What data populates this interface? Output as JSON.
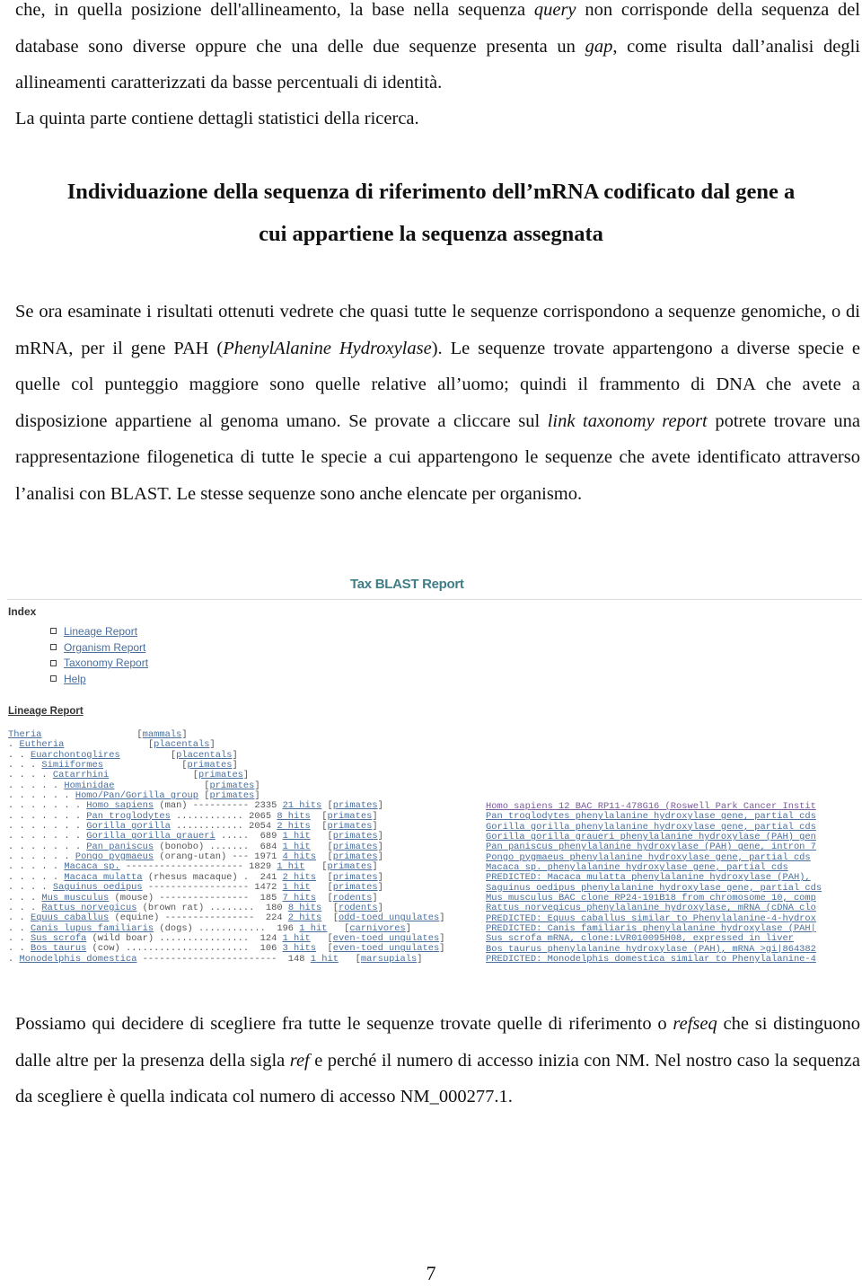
{
  "intro": {
    "p1_a": "che, in quella posizione dell'allineamento, la base nella sequenza ",
    "p1_query": "query",
    "p1_b": " non corrisponde della sequenza del database sono diverse oppure che una delle due sequenze presenta un ",
    "p1_gap": "gap",
    "p1_c": ", come risulta dall’analisi degli allineamenti caratterizzati da basse percentuali di identità.",
    "p2": "La quinta parte contiene dettagli statistici della ricerca."
  },
  "section_heading": {
    "line1": "Individuazione della sequenza di riferimento dell’mRNA codificato dal gene a",
    "line2": "cui appartiene la sequenza assegnata"
  },
  "body": {
    "a": "Se ora esaminate i risultati ottenuti vedrete che quasi tutte le sequenze corrispondono a sequenze genomiche, o di mRNA, per il gene PAH (",
    "pah_italic": "PhenylAlanine Hydroxylase",
    "b": "). Le sequenze trovate appartengono a diverse specie e quelle col punteggio maggiore sono quelle relative all’uomo; quindi il frammento di DNA che avete a disposizione appartiene al genoma umano. Se provate a cliccare sul ",
    "link_italic": "link taxonomy report",
    "c": " potrete trovare una rappresentazione filogenetica di tutte le specie a cui appartengono le sequenze che avete identificato attraverso l’analisi con BLAST. Le stesse sequenze sono anche elencate per organismo."
  },
  "report": {
    "title": "Tax BLAST Report",
    "index_label": "Index",
    "index_links": [
      "Lineage Report",
      "Organism Report",
      "Taxonomy Report",
      "Help"
    ],
    "lineage_label": "Lineage Report",
    "lineage_header_rows": [
      {
        "prefix": "",
        "name": "Theria",
        "pad": "                 [",
        "group": "mammals",
        "end": "]"
      },
      {
        "prefix": ". ",
        "name": "Eutheria",
        "pad": "               [",
        "group": "placentals",
        "end": "]"
      },
      {
        "prefix": ". . ",
        "name": "Euarchontoglires",
        "pad": "         [",
        "group": "placentals",
        "end": "]"
      },
      {
        "prefix": ". . . ",
        "name": "Simiiformes",
        "pad": "              [",
        "group": "primates",
        "end": "]"
      },
      {
        "prefix": ". . . . ",
        "name": "Catarrhini",
        "pad": "               [",
        "group": "primates",
        "end": "]"
      },
      {
        "prefix": ". . . . . ",
        "name": "Hominidae",
        "pad": "                [",
        "group": "primates",
        "end": "]"
      },
      {
        "prefix": ". . . . . . ",
        "name": "Homo/Pan/Gorilla group",
        "pad": " [",
        "group": "primates",
        "end": "]"
      }
    ],
    "organisms": [
      {
        "prefix": ". . . . . . . ",
        "name": "Homo sapiens",
        "fill": " (man) ---------- ",
        "score": "2335",
        "hits": "21 hits",
        "group": "primates",
        "description": "Homo sapiens 12 BAC RP11-478G16 (Roswell Park Cancer Instit"
      },
      {
        "prefix": ". . . . . . . ",
        "name": "Pan troglodytes",
        "fill": " ............ ",
        "score": "2065",
        "hits": "8 hits",
        "group": "primates",
        "description": "Pan troglodytes phenylalanine hydroxylase gene, partial cds"
      },
      {
        "prefix": ". . . . . . . ",
        "name": "Gorilla gorilla",
        "fill": " ............ ",
        "score": "2054",
        "hits": "2 hits",
        "group": "primates",
        "description": "Gorilla gorilla phenylalanine hydroxylase gene, partial cds"
      },
      {
        "prefix": ". . . . . . . ",
        "name": "Gorilla gorilla graueri",
        "fill": " ..... ",
        "score": "689",
        "hits": "1 hit",
        "group": "primates",
        "description": "Gorilla gorilla graueri phenylalanine hydroxylase (PAH) gen"
      },
      {
        "prefix": ". . . . . . . ",
        "name": "Pan paniscus",
        "fill": " (bonobo) ....... ",
        "score": "684",
        "hits": "1 hit",
        "group": "primates",
        "description": "Pan paniscus phenylalanine hydroxylase (PAH) gene, intron 7"
      },
      {
        "prefix": ". . . . . . ",
        "name": "Pongo pygmaeus",
        "fill": " (orang-utan) --- ",
        "score": "1971",
        "hits": "4 hits",
        "group": "primates",
        "description": "Pongo pygmaeus phenylalanine hydroxylase gene, partial cds"
      },
      {
        "prefix": ". . . . . ",
        "name": "Macaca sp.",
        "fill": " --------------------- ",
        "score": "1829",
        "hits": "1 hit",
        "group": "primates",
        "description": "Macaca sp. phenylalanine hydroxylase gene, partial cds"
      },
      {
        "prefix": ". . . . . ",
        "name": "Macaca mulatta",
        "fill": " (rhesus macaque) . ",
        "score": "241",
        "hits": "2 hits",
        "group": "primates",
        "description": "PREDICTED: Macaca mulatta phenylalanine hydroxylase (PAH),"
      },
      {
        "prefix": ". . . . ",
        "name": "Saguinus oedipus",
        "fill": " ------------------ ",
        "score": "1472",
        "hits": "1 hit",
        "group": "primates",
        "description": "Saguinus oedipus phenylalanine hydroxylase gene, partial cds"
      },
      {
        "prefix": ". . . ",
        "name": "Mus musculus",
        "fill": " (mouse) ---------------- ",
        "score": "185",
        "hits": "7 hits",
        "group": "rodents",
        "description": "Mus musculus BAC clone RP24-191B18 from chromosome 10, comp"
      },
      {
        "prefix": ". . . ",
        "name": "Rattus norvegicus",
        "fill": " (brown rat) ........ ",
        "score": "180",
        "hits": "8 hits",
        "group": "rodents",
        "description": "Rattus norvegicus phenylalanine hydroxylase, mRNA (cDNA clo"
      },
      {
        "prefix": ". . ",
        "name": "Equus caballus",
        "fill": " (equine) ---------------- ",
        "score": "224",
        "hits": "2 hits",
        "group": "odd-toed ungulates",
        "description": "PREDICTED: Equus caballus similar to Phenylalanine-4-hydrox"
      },
      {
        "prefix": ". . ",
        "name": "Canis lupus familiaris",
        "fill": " (dogs) ............ ",
        "score": "196",
        "hits": "1 hit",
        "group": "carnivores",
        "description": "PREDICTED: Canis familiaris phenylalanine hydroxylase (PAH|"
      },
      {
        "prefix": ". . ",
        "name": "Sus scrofa",
        "fill": " (wild boar) ................ ",
        "score": "124",
        "hits": "1 hit",
        "group": "even-toed ungulates",
        "description": "Sus scrofa mRNA, clone:LVR010095H08, expressed in liver"
      },
      {
        "prefix": ". . ",
        "name": "Bos taurus",
        "fill": " (cow) ...................... ",
        "score": "106",
        "hits": "3 hits",
        "group": "even-toed ungulates",
        "description": "Bos taurus phenylalanine hydroxylase (PAH), mRNA >gi|864382"
      },
      {
        "prefix": ". ",
        "name": "Monodelphis domestica",
        "fill": " ------------------------ ",
        "score": "148",
        "hits": "1 hit",
        "group": "marsupials",
        "description": "PREDICTED: Monodelphis domestica similar to Phenylalanine-4"
      }
    ]
  },
  "conclusion": {
    "a": "Possiamo qui decidere di scegliere fra tutte le sequenze trovate quelle di riferimento o ",
    "refseq_italic": "refseq",
    "b": " che si distinguono dalle altre per la presenza della sigla ",
    "ref_italic": "ref",
    "c": " e perché il numero di accesso inizia con NM. Nel nostro caso la sequenza da scegliere è quella indicata col numero di accesso NM_000277.1."
  },
  "page_number": "7"
}
